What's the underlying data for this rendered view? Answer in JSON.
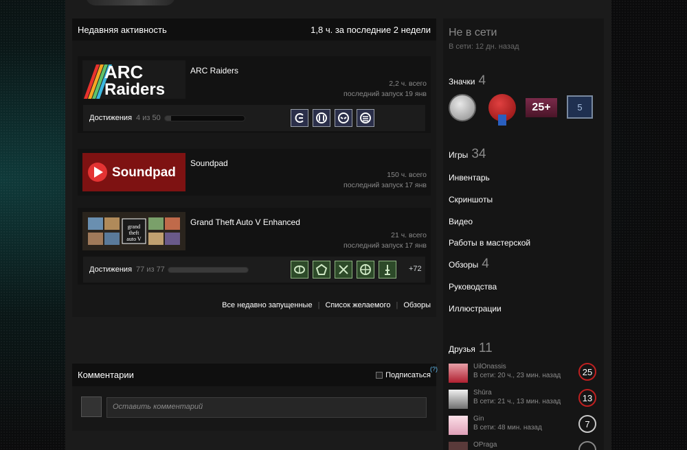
{
  "recent": {
    "title": "Недавняя активность",
    "hours": "1,8 ч. за последние 2 недели",
    "games": [
      {
        "name": "ARC Raiders",
        "logo": "ARC Raiders",
        "total": "2,2 ч. всего",
        "last": "последний запуск 19 янв",
        "ach_label": "Достижения",
        "ach_count": "4 из 50",
        "ach_progress": 0.08,
        "icons": [
          "spiral-icon",
          "ring-icon",
          "mask-icon",
          "stack-icon"
        ],
        "more": ""
      },
      {
        "name": "Soundpad",
        "logo": "Soundpad",
        "total": "150 ч. всего",
        "last": "последний запуск 17 янв"
      },
      {
        "name": "Grand Theft Auto V Enhanced",
        "logo": "grand theft auto V",
        "total": "21 ч. всего",
        "last": "последний запуск 17 янв",
        "ach_label": "Достижения",
        "ach_count": "77 из 77",
        "ach_progress": 1.0,
        "icons": [
          "brain-icon",
          "shield-icon",
          "swords-icon",
          "globe-icon",
          "tower-icon"
        ],
        "more": "+72"
      }
    ],
    "links": [
      "Все недавно запущенные",
      "Список желаемого",
      "Обзоры"
    ]
  },
  "comments": {
    "title": "Комментарии",
    "subscribe": "Подписаться",
    "help": "(?)",
    "placeholder": "Оставить комментарий"
  },
  "profile": {
    "status": "Не в сети",
    "since": "В сети: 12 дн. назад",
    "badges_label": "Значки",
    "badges_count": "4",
    "badge_level": "25+",
    "badge_num": "5",
    "games_label": "Игры",
    "games_count": "34",
    "nav": [
      "Инвентарь",
      "Скриншоты",
      "Видео",
      "Работы в мастерской"
    ],
    "reviews_label": "Обзоры",
    "reviews_count": "4",
    "nav2": [
      "Руководства",
      "Иллюстрации"
    ],
    "friends_label": "Друзья",
    "friends_count": "11",
    "friends": [
      {
        "name": "UilOnassis",
        "status": "В сети: 20 ч., 23 мин. назад",
        "level": "25"
      },
      {
        "name": "Shūra",
        "status": "В сети: 21 ч., 13 мин. назад",
        "level": "13"
      },
      {
        "name": "Gin",
        "status": "В сети: 48 мин. назад",
        "level": "7"
      },
      {
        "name": "OPraga",
        "status": "",
        "level": ""
      }
    ]
  },
  "colors": {
    "accent": "#66c0f4",
    "level_red": "#c02020",
    "ach_green": "#2d4a29"
  }
}
